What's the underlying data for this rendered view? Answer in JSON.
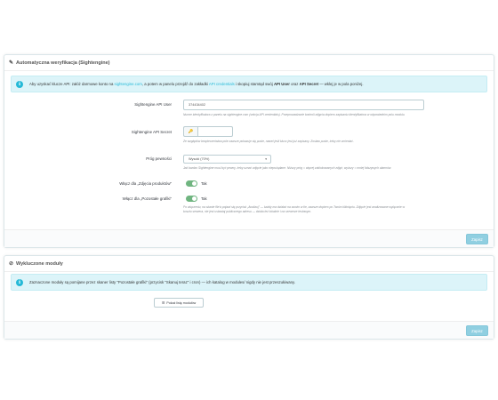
{
  "panel1": {
    "heading": "Automatyczna weryfikacja (Sightengine)",
    "heading_icon": "pencil-icon",
    "alert": {
      "text_before": "Aby uzyskać klucze API: załóż darmowe konto na ",
      "link1": "sightengine.com",
      "text_mid1": ", a potem w panelu przejdź do zakładki ",
      "link2": "API credentials",
      "text_mid2": " i skopiuj stamtąd swój ",
      "bold1": "API User",
      "text_mid3": " oraz ",
      "bold2": "API Secret",
      "text_after": " — wklej je w pola poniżej."
    },
    "api_user": {
      "label": "Sightengine API User",
      "value": "374434402",
      "help": "Numer identyfikatora z panelu na sightengine.com (sekcja API credentials). Przeprowadzanie kontroli zdjęcia dopiero zapisaniu identyfikatora w odpowiednim polu modułu."
    },
    "api_secret": {
      "label": "Sightengine API Secret",
      "addon_icon": "key-icon",
      "help": "Ze względów bezpieczeństwa pole zawsze pokazuje się puste, nawet jeśli klucz jest już zapisany. Zostaw puste, żeby nie zmieniać."
    },
    "threshold": {
      "label": "Próg pewności",
      "selected": "Wysoki (70%)",
      "help": "Jak bardzo Sightengine musi być pewny, żeby uznać zdjęcie jako niepożądane. Niższy próg = więcej zablokowanych zdjęć; wyższy = mniej fałszywych alarmów."
    },
    "toggle_products": {
      "label": "Włącz dla „Zdjęcia produktów”",
      "state": "Tak"
    },
    "toggle_other": {
      "label": "Włącz dla „Pozostałe grafiki”",
      "state": "Tak",
      "help_line1": "Po włączeniu, na skanie file'a pojawi się przycisk „Analizuj” — każdy ma działać na swoim w tle, zawsze dopiero po Twoim kliknięciu. Zdjęcie jest analizowane wyłącznie w",
      "help_line2": "kosztu serwera, nie jest ustawiaj publicznego adresu — działa też lokalnie i na serwerze testowym."
    },
    "save_label": "Zapisz"
  },
  "panel2": {
    "heading": "Wykluczone moduły",
    "heading_icon": "ban-icon",
    "alert": {
      "text": "Zaznaczone moduły są pomijane przez skaner listy \"Pozostałe grafiki\" (przycisk \"Skanuj teraz\" i cron) — ich katalog w modules/ nigdy nie jest przeszukiwany."
    },
    "show_modules_label": "Pokaż listę modułów",
    "show_modules_icon": "list-icon",
    "save_label": "Zapisz"
  },
  "colors": {
    "accent": "#25b9d7",
    "alert_bg": "#dcf4f9",
    "toggle_on": "#70b580",
    "save_btn": "#90cfe1"
  }
}
